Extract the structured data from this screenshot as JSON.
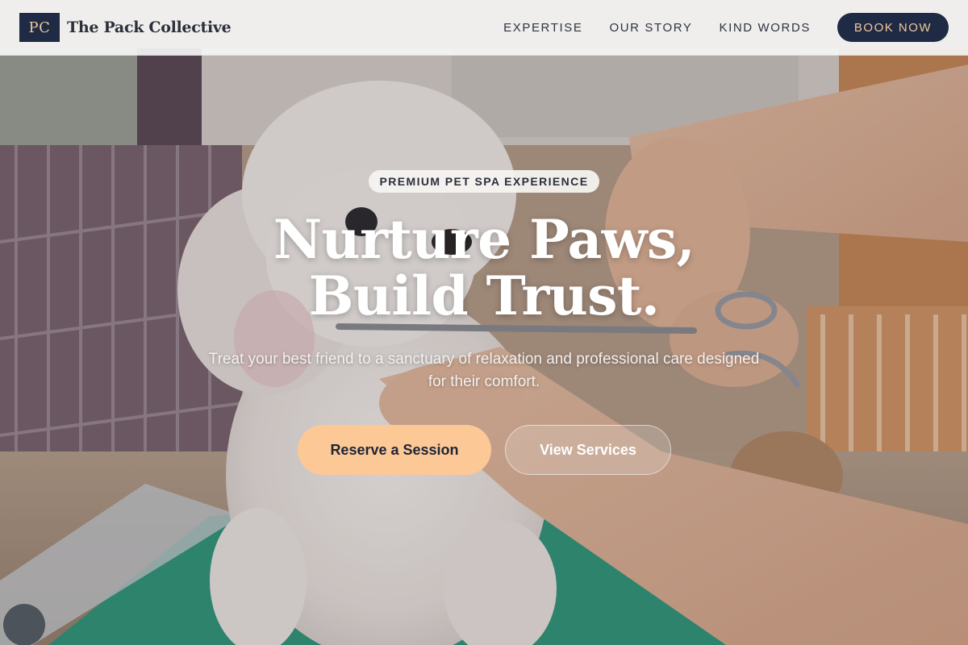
{
  "header": {
    "logo_mark": "PC",
    "brand_name": "The Pack Collective",
    "nav": [
      {
        "label": "EXPERTISE"
      },
      {
        "label": "OUR STORY"
      },
      {
        "label": "KIND WORDS"
      }
    ],
    "book_label": "BOOK NOW"
  },
  "hero": {
    "badge": "PREMIUM PET SPA EXPERIENCE",
    "headline_line1": "Nurture Paws,",
    "headline_line2": "Build Trust.",
    "subtext": "Treat your best friend to a sanctuary of relaxation and professional care designed for their comfort.",
    "primary_cta": "Reserve a Session",
    "secondary_cta": "View Services"
  },
  "colors": {
    "navy": "#1f2a44",
    "peach": "#fcc896",
    "accent_text": "#f4c89b"
  }
}
